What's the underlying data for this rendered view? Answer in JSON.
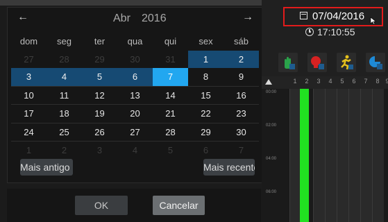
{
  "calendar": {
    "month": "Abr",
    "year": "2016",
    "prev_icon": "left-arrow-icon",
    "next_icon": "right-arrow-icon",
    "weekdays": [
      "dom",
      "seg",
      "ter",
      "qua",
      "qui",
      "sex",
      "sáb"
    ],
    "weeks": [
      [
        "27",
        "28",
        "29",
        "30",
        "31",
        "1",
        "2"
      ],
      [
        "3",
        "4",
        "5",
        "6",
        "7",
        "8",
        "9"
      ],
      [
        "10",
        "11",
        "12",
        "13",
        "14",
        "15",
        "16"
      ],
      [
        "17",
        "18",
        "19",
        "20",
        "21",
        "22",
        "23"
      ],
      [
        "24",
        "25",
        "26",
        "27",
        "28",
        "29",
        "30"
      ],
      [
        "1",
        "2",
        "3",
        "4",
        "5",
        "6",
        "7"
      ]
    ],
    "older_button": "Mais antigo",
    "newer_button": "Mais recente",
    "colors": {
      "selected": "#164a73",
      "today": "#22a7f0"
    }
  },
  "dialog": {
    "ok": "OK",
    "cancel": "Cancelar"
  },
  "panel": {
    "date": "07/04/2016",
    "date_icon": "calendar-icon",
    "time": "17:10:55",
    "time_icon": "clock-icon",
    "highlight_color": "#e21b1b",
    "tools": [
      "hand-icon",
      "head-icon",
      "runner-icon",
      "pie-icon"
    ],
    "channels": [
      "1",
      "2",
      "3",
      "4",
      "5",
      "6",
      "7",
      "8",
      "9"
    ],
    "times": [
      "00:00",
      "02:00",
      "04:00",
      "06:00"
    ],
    "record_color": "#21e021"
  }
}
